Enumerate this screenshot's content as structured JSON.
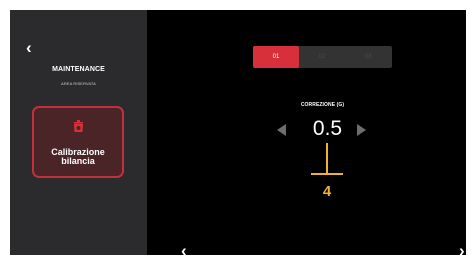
{
  "sidebar": {
    "back_glyph": "‹",
    "title": "MAINTENANCE",
    "subtitle": "AREA RISERVATA",
    "calibration_button": {
      "icon": "scale-icon",
      "label_line1": "Calibrazione",
      "label_line2": "bilancia"
    }
  },
  "main": {
    "tabs": [
      {
        "label": "01",
        "active": true
      },
      {
        "label": "02",
        "active": false
      },
      {
        "label": "03",
        "active": false
      }
    ],
    "parameter": {
      "label": "CORREZIONE (G)",
      "value": "0.5",
      "decrease_icon": "triangle-left-icon",
      "increase_icon": "triangle-right-icon"
    },
    "annotation": {
      "number": "4"
    },
    "nav": {
      "back_glyph": "‹",
      "forward_glyph": "›"
    }
  },
  "colors": {
    "accent": "#d8303a",
    "sidebar_bg": "#2b2b2d",
    "annotation": "#f0b232",
    "background": "#000000"
  }
}
